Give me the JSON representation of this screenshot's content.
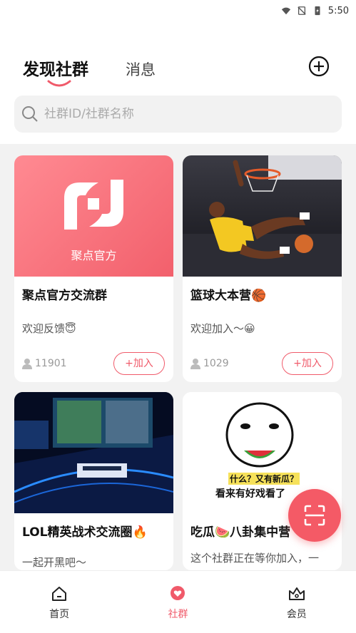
{
  "status_bar": {
    "time": "5:50"
  },
  "header": {
    "tabs": [
      {
        "label": "发现社群",
        "active": true
      },
      {
        "label": "消息",
        "active": false
      }
    ],
    "search": {
      "placeholder": "社群ID/社群名称"
    }
  },
  "cards": [
    {
      "thumb_text": "聚点官方",
      "title": "聚点官方交流群",
      "desc": "欢迎反馈😇",
      "count": "11901",
      "join_label": "+加入"
    },
    {
      "title": "篮球大本营🏀",
      "desc": "欢迎加入～😀",
      "count": "1029",
      "join_label": "+加入"
    },
    {
      "title": "LOL精英战术交流圈🔥",
      "desc": "一起开黑吧～"
    },
    {
      "thumb_text_1": "什么？又有新瓜？",
      "thumb_text_2": "看来有好戏看了",
      "title": "吃瓜🍉八卦集中营",
      "desc": "这个社群正在等你加入，一"
    }
  ],
  "bottom_nav": [
    {
      "label": "首页",
      "icon": "home-icon",
      "active": false
    },
    {
      "label": "社群",
      "icon": "heart-chat-icon",
      "active": true
    },
    {
      "label": "会员",
      "icon": "crown-icon",
      "active": false
    }
  ],
  "colors": {
    "accent": "#f05a6a",
    "fab": "#f45a66"
  }
}
